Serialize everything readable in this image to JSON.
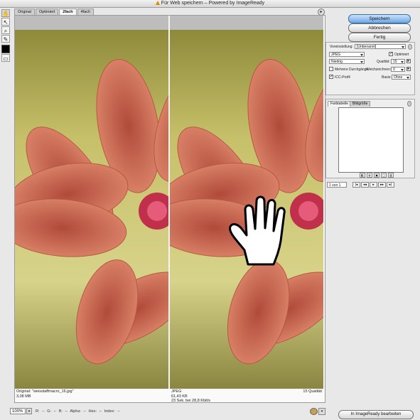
{
  "window": {
    "title": "Für Web speichern – Powered by ImageReady"
  },
  "tabs": [
    "Original",
    "Optimiert",
    "2fach",
    "4fach"
  ],
  "active_tab": "2fach",
  "tools": [
    "hand-tool",
    "slice-select-tool",
    "zoom-tool",
    "eyedropper-tool"
  ],
  "panes": {
    "left": {
      "line1": "Original: \"weisstaffmacro_16.jpg\"",
      "line2": "3,08 MB"
    },
    "right": {
      "line1": "JPEG",
      "line2": "61,43 KB",
      "line3": "23 Sek. bei 28,8 Kbit/s",
      "quality": "15 Qualität"
    }
  },
  "statusbar": {
    "zoom": "100%",
    "readout": "R: --  G: --  B: --  Alpha: --  Hex: --  Index: --"
  },
  "buttons": {
    "save": "Speichern",
    "cancel": "Abbrechen",
    "done": "Fertig",
    "imageready": "In ImageReady bearbeiten"
  },
  "settings": {
    "preset_label": "Voreinstellung:",
    "preset_value": "[Unbenannt]",
    "format": "JPEG",
    "optimized_label": "Optimiert",
    "optimized_checked": true,
    "quality_preset": "Niedrig",
    "quality_label": "Qualität:",
    "quality_value": "15",
    "progressive_label": "Mehrere Durchgänge",
    "progressive_checked": false,
    "blur_label": "Weichzeichnen:",
    "blur_value": "0",
    "icc_label": "ICC-Profil",
    "icc_checked": true,
    "matte_label": "Basis:",
    "matte_value": "Ohne"
  },
  "color_panel": {
    "tabs": [
      "Farbtabelle",
      "Bildgröße"
    ],
    "active": "Farbtabelle"
  },
  "animation": {
    "frame": "1 von 1"
  },
  "colors": {
    "accent": "#6aa7e6",
    "photo_bg": "#b8b05a",
    "petal": "#d9735a"
  }
}
